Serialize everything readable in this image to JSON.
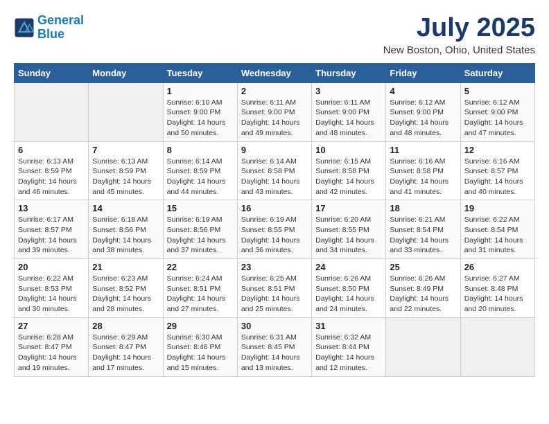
{
  "header": {
    "logo_line1": "General",
    "logo_line2": "Blue",
    "title": "July 2025",
    "subtitle": "New Boston, Ohio, United States"
  },
  "days_of_week": [
    "Sunday",
    "Monday",
    "Tuesday",
    "Wednesday",
    "Thursday",
    "Friday",
    "Saturday"
  ],
  "weeks": [
    [
      {
        "day": "",
        "info": ""
      },
      {
        "day": "",
        "info": ""
      },
      {
        "day": "1",
        "info": "Sunrise: 6:10 AM\nSunset: 9:00 PM\nDaylight: 14 hours and 50 minutes."
      },
      {
        "day": "2",
        "info": "Sunrise: 6:11 AM\nSunset: 9:00 PM\nDaylight: 14 hours and 49 minutes."
      },
      {
        "day": "3",
        "info": "Sunrise: 6:11 AM\nSunset: 9:00 PM\nDaylight: 14 hours and 48 minutes."
      },
      {
        "day": "4",
        "info": "Sunrise: 6:12 AM\nSunset: 9:00 PM\nDaylight: 14 hours and 48 minutes."
      },
      {
        "day": "5",
        "info": "Sunrise: 6:12 AM\nSunset: 9:00 PM\nDaylight: 14 hours and 47 minutes."
      }
    ],
    [
      {
        "day": "6",
        "info": "Sunrise: 6:13 AM\nSunset: 8:59 PM\nDaylight: 14 hours and 46 minutes."
      },
      {
        "day": "7",
        "info": "Sunrise: 6:13 AM\nSunset: 8:59 PM\nDaylight: 14 hours and 45 minutes."
      },
      {
        "day": "8",
        "info": "Sunrise: 6:14 AM\nSunset: 8:59 PM\nDaylight: 14 hours and 44 minutes."
      },
      {
        "day": "9",
        "info": "Sunrise: 6:14 AM\nSunset: 8:58 PM\nDaylight: 14 hours and 43 minutes."
      },
      {
        "day": "10",
        "info": "Sunrise: 6:15 AM\nSunset: 8:58 PM\nDaylight: 14 hours and 42 minutes."
      },
      {
        "day": "11",
        "info": "Sunrise: 6:16 AM\nSunset: 8:58 PM\nDaylight: 14 hours and 41 minutes."
      },
      {
        "day": "12",
        "info": "Sunrise: 6:16 AM\nSunset: 8:57 PM\nDaylight: 14 hours and 40 minutes."
      }
    ],
    [
      {
        "day": "13",
        "info": "Sunrise: 6:17 AM\nSunset: 8:57 PM\nDaylight: 14 hours and 39 minutes."
      },
      {
        "day": "14",
        "info": "Sunrise: 6:18 AM\nSunset: 8:56 PM\nDaylight: 14 hours and 38 minutes."
      },
      {
        "day": "15",
        "info": "Sunrise: 6:19 AM\nSunset: 8:56 PM\nDaylight: 14 hours and 37 minutes."
      },
      {
        "day": "16",
        "info": "Sunrise: 6:19 AM\nSunset: 8:55 PM\nDaylight: 14 hours and 36 minutes."
      },
      {
        "day": "17",
        "info": "Sunrise: 6:20 AM\nSunset: 8:55 PM\nDaylight: 14 hours and 34 minutes."
      },
      {
        "day": "18",
        "info": "Sunrise: 6:21 AM\nSunset: 8:54 PM\nDaylight: 14 hours and 33 minutes."
      },
      {
        "day": "19",
        "info": "Sunrise: 6:22 AM\nSunset: 8:54 PM\nDaylight: 14 hours and 31 minutes."
      }
    ],
    [
      {
        "day": "20",
        "info": "Sunrise: 6:22 AM\nSunset: 8:53 PM\nDaylight: 14 hours and 30 minutes."
      },
      {
        "day": "21",
        "info": "Sunrise: 6:23 AM\nSunset: 8:52 PM\nDaylight: 14 hours and 28 minutes."
      },
      {
        "day": "22",
        "info": "Sunrise: 6:24 AM\nSunset: 8:51 PM\nDaylight: 14 hours and 27 minutes."
      },
      {
        "day": "23",
        "info": "Sunrise: 6:25 AM\nSunset: 8:51 PM\nDaylight: 14 hours and 25 minutes."
      },
      {
        "day": "24",
        "info": "Sunrise: 6:26 AM\nSunset: 8:50 PM\nDaylight: 14 hours and 24 minutes."
      },
      {
        "day": "25",
        "info": "Sunrise: 6:26 AM\nSunset: 8:49 PM\nDaylight: 14 hours and 22 minutes."
      },
      {
        "day": "26",
        "info": "Sunrise: 6:27 AM\nSunset: 8:48 PM\nDaylight: 14 hours and 20 minutes."
      }
    ],
    [
      {
        "day": "27",
        "info": "Sunrise: 6:28 AM\nSunset: 8:47 PM\nDaylight: 14 hours and 19 minutes."
      },
      {
        "day": "28",
        "info": "Sunrise: 6:29 AM\nSunset: 8:47 PM\nDaylight: 14 hours and 17 minutes."
      },
      {
        "day": "29",
        "info": "Sunrise: 6:30 AM\nSunset: 8:46 PM\nDaylight: 14 hours and 15 minutes."
      },
      {
        "day": "30",
        "info": "Sunrise: 6:31 AM\nSunset: 8:45 PM\nDaylight: 14 hours and 13 minutes."
      },
      {
        "day": "31",
        "info": "Sunrise: 6:32 AM\nSunset: 8:44 PM\nDaylight: 14 hours and 12 minutes."
      },
      {
        "day": "",
        "info": ""
      },
      {
        "day": "",
        "info": ""
      }
    ]
  ]
}
